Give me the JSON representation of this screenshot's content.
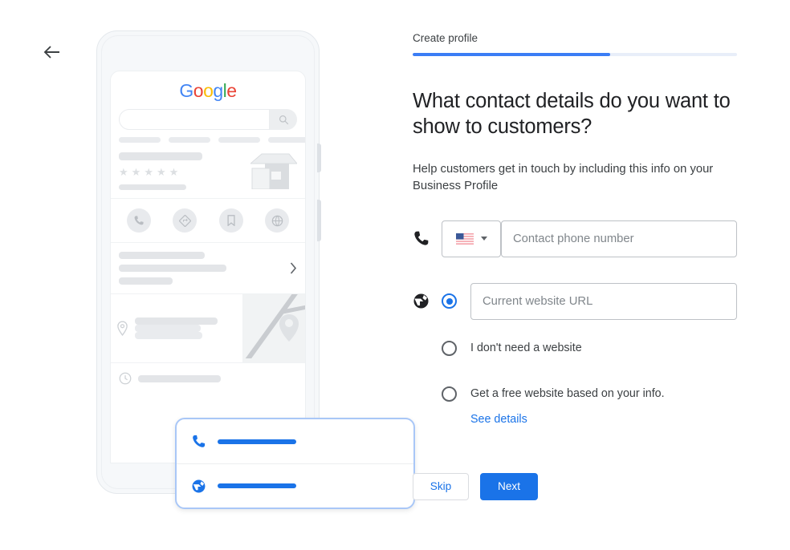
{
  "nav": {
    "back_icon": "arrow-left-icon"
  },
  "progress": {
    "step_label": "Create profile",
    "percent": 61,
    "fill_color": "#3b7df5",
    "track_color": "#e8eef9"
  },
  "main": {
    "heading": "What contact details do you want to show to customers?",
    "subtext": "Help customers get in touch by including this info on your Business Profile"
  },
  "phone_field": {
    "icon": "phone-icon",
    "country_code_flag": "us-flag-icon",
    "country_code_caret": "caret-down-icon",
    "placeholder": "Contact phone number",
    "value": ""
  },
  "website_field": {
    "icon": "globe-icon",
    "placeholder": "Current website URL",
    "value": "",
    "selected": true
  },
  "website_options": [
    {
      "label": "I don't need a website",
      "selected": false
    },
    {
      "label": "Get a free website based on your info.",
      "selected": false,
      "link": "See details"
    }
  ],
  "buttons": {
    "skip": "Skip",
    "next": "Next",
    "primary_color": "#1a73e8"
  },
  "phone_mock": {
    "google_logo": [
      "G",
      "o",
      "o",
      "g",
      "l",
      "e"
    ],
    "logo_colors": [
      "#4285f4",
      "#ea4335",
      "#fbbc05",
      "#4285f4",
      "#34a853",
      "#ea4335"
    ],
    "search_icon": "search-icon",
    "stars": "★★★★★",
    "action_icons": [
      "phone-icon",
      "directions-icon",
      "bookmark-icon",
      "globe-icon"
    ],
    "chevron_icon": "chevron-right-icon",
    "location_icon": "location-pin-icon",
    "clock_icon": "clock-icon",
    "callout": {
      "rows": [
        {
          "icon": "phone-icon"
        },
        {
          "icon": "globe-icon"
        }
      ],
      "border_color": "#a9c7f7",
      "bar_color": "#1a73e8"
    }
  }
}
